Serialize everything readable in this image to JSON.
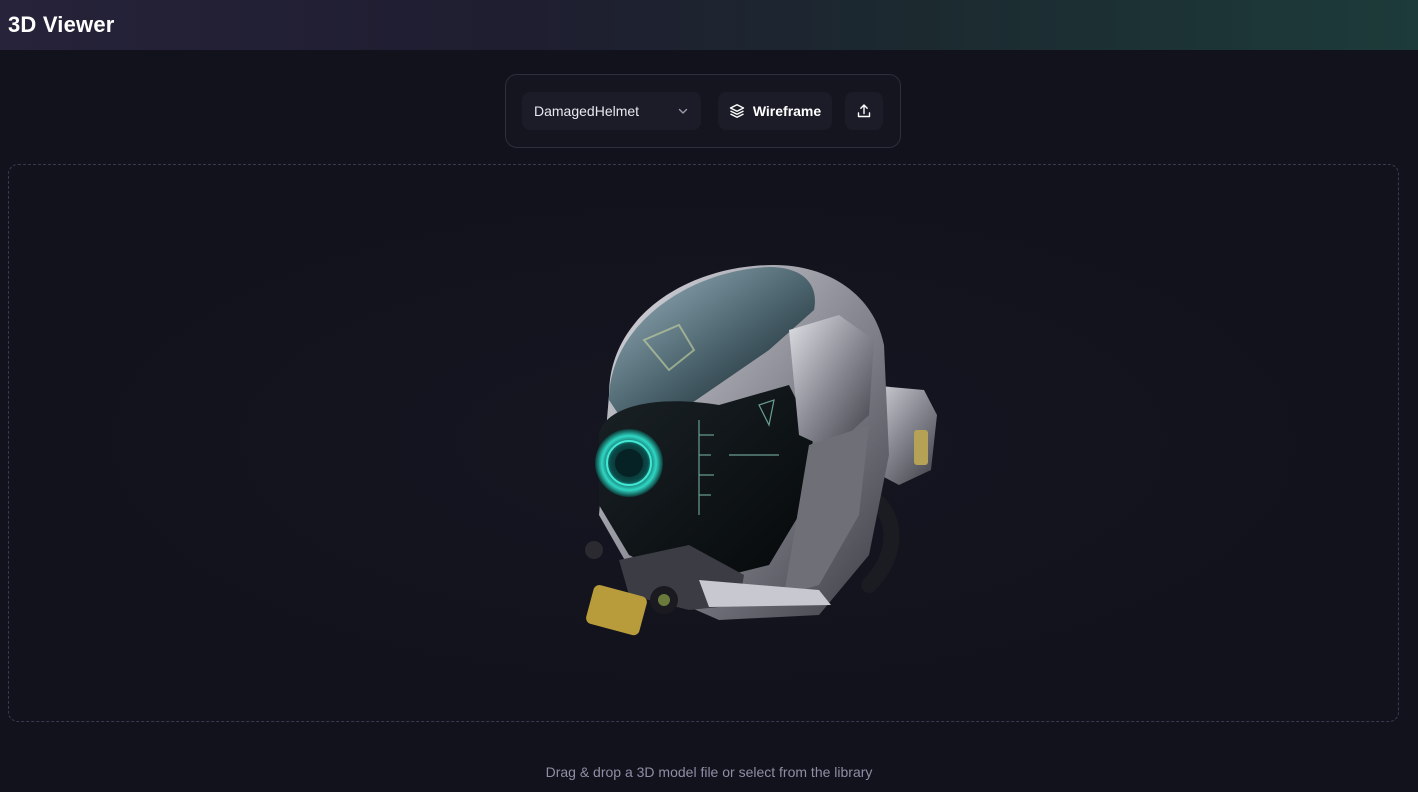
{
  "app": {
    "title": "3D Viewer"
  },
  "toolbar": {
    "model_select": {
      "value": "DamagedHelmet",
      "icon": "chevron-down-icon"
    },
    "wireframe_button": {
      "label": "Wireframe",
      "icon": "layers-icon"
    },
    "upload_button": {
      "icon": "upload-icon"
    }
  },
  "viewport": {
    "model_name": "DamagedHelmet"
  },
  "footer": {
    "hint": "Drag & drop a 3D model file or select from the library"
  },
  "colors": {
    "background": "#12121c",
    "viewport_border": "#3b3856",
    "hud_accent": "#2fd7c4"
  }
}
